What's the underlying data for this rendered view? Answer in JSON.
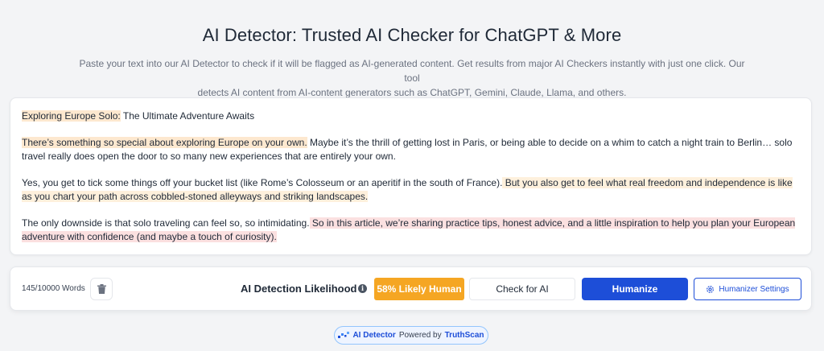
{
  "header": {
    "title": "AI Detector: Trusted AI Checker for ChatGPT & More",
    "subtitle_line1": "Paste your text into our AI Detector to check if it will be flagged as AI-generated content. Get results from major AI Checkers instantly with just one click. Our tool",
    "subtitle_line2": "detects AI content from AI-content generators such as ChatGPT, Gemini, Claude, Llama, and others."
  },
  "editor": {
    "title_hl": "Exploring Europe Solo:",
    "title_rest": " The Ultimate Adventure Awaits",
    "p1_hl": " There’s something so special about exploring Europe on your own.",
    "p1_rest": " Maybe it’s the thrill of getting lost in Paris, or being able to decide on a whim to catch a night train to Berlin… solo travel really does open the door to so many new experiences that are entirely your own.",
    "p2_plain": " Yes, you get to tick some things off your bucket list (like Rome’s Colosseum or an aperitif in the south of France).",
    "p2_hl": " But you also get to feel what real freedom and independence is like as you chart your path across cobbled-stoned alleyways and striking landscapes.",
    "p3_plain": " The only downside is that solo traveling can feel so, so intimidating.",
    "p3_hl": " So in this article, we’re sharing practice tips, honest advice, and a little inspiration to help you plan your European adventure with confidence (and maybe a touch of curiosity)."
  },
  "toolbar": {
    "word_count": "145/10000 Words",
    "likelihood_label": "AI Detection Likelihood",
    "likely_badge": "58% Likely Human",
    "check_label": "Check for AI",
    "humanize_label": "Humanize",
    "settings_label": "Humanizer Settings"
  },
  "footer": {
    "brand": "AI Detector",
    "powered_by": "Powered by",
    "provider": "TruthScan"
  },
  "colors": {
    "accent": "#1d4ed8",
    "badge": "#f5a623",
    "highlight_orange": "#fde8cf",
    "highlight_pink": "#fbe0e0"
  }
}
